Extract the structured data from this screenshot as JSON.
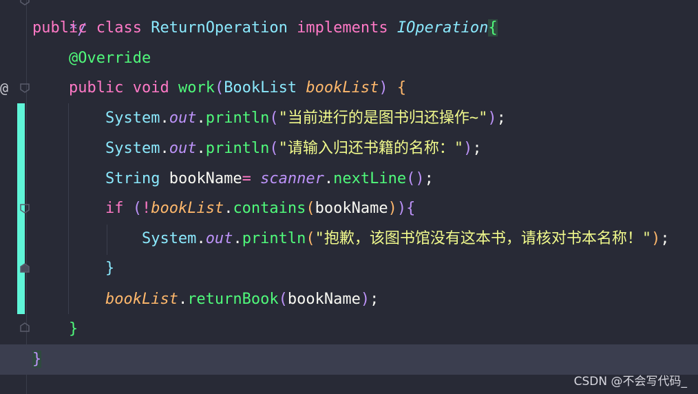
{
  "editor": {
    "colors": {
      "background": "#282a36",
      "keyword": "#ff79c6",
      "class_name": "#8be9fd",
      "function": "#50fa7b",
      "parameter": "#ffb86c",
      "field": "#bd93f9",
      "string": "#f1fa8c",
      "change_bar": "#5ff5d8",
      "current_line": "#3b3e4f"
    },
    "gutter": {
      "override_marker": "@",
      "fold_icon": "fold-marker-icon"
    },
    "code": {
      "top_fragment": "*/",
      "l1": {
        "kw_public": "public",
        "kw_class": "class",
        "class_name": "ReturnOperation",
        "kw_implements": "implements",
        "iface": "IOperation",
        "open_brace": "{"
      },
      "l2": {
        "annotation": "@Override"
      },
      "l3": {
        "kw_public": "public",
        "kw_void": "void",
        "method": "work",
        "paren_open": "(",
        "type": "BookList",
        "param": "bookList",
        "paren_close": ")",
        "open_brace": "{"
      },
      "l4": {
        "system": "System",
        "dot1": ".",
        "out": "out",
        "dot2": ".",
        "println": "println",
        "paren_open": "(",
        "str": "\"当前进行的是图书归还操作~\"",
        "paren_close": ")",
        "semi": ";"
      },
      "l5": {
        "system": "System",
        "dot1": ".",
        "out": "out",
        "dot2": ".",
        "println": "println",
        "paren_open": "(",
        "str": "\"请输入归还书籍的名称：\"",
        "paren_close": ")",
        "semi": ";"
      },
      "l6": {
        "type": "String",
        "var": "bookName",
        "assign": "=",
        "scanner": "scanner",
        "dot": ".",
        "method": "nextLine",
        "parens": "()",
        "semi": ";"
      },
      "l7": {
        "kw_if": "if",
        "paren_open": "(",
        "not": "!",
        "param": "bookList",
        "dot": ".",
        "method": "contains",
        "inner_open": "(",
        "arg": "bookName",
        "inner_close": ")",
        "paren_close": ")",
        "open_brace": "{"
      },
      "l8": {
        "system": "System",
        "dot1": ".",
        "out": "out",
        "dot2": ".",
        "println": "println",
        "paren_open": "(",
        "str": "\"抱歉，该图书馆没有这本书，请核对书本名称！\"",
        "paren_close": ")",
        "semi": ";"
      },
      "l9": {
        "close_brace": "}"
      },
      "l10": {
        "param": "bookList",
        "dot": ".",
        "method": "returnBook",
        "paren_open": "(",
        "arg": "bookName",
        "paren_close": ")",
        "semi": ";"
      },
      "l11": {
        "close_brace": "}"
      },
      "l12": {
        "close_brace": "}"
      }
    }
  },
  "watermark": {
    "text": "CSDN @不会写代码_"
  }
}
